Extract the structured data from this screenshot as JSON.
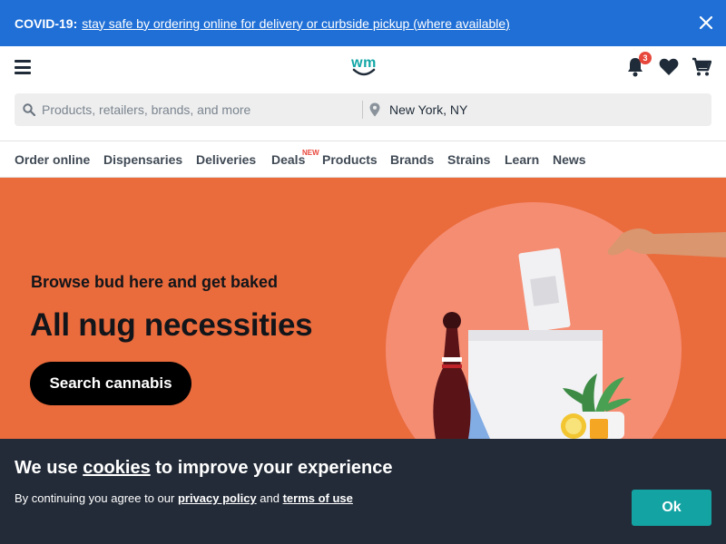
{
  "covid": {
    "label": "COVID-19:",
    "message": "stay safe by ordering online for delivery or curbside pickup (where available)"
  },
  "header": {
    "logo_text": "wm",
    "notification_count": "3"
  },
  "search": {
    "placeholder": "Products, retailers, brands, and more",
    "location_value": "New York, NY"
  },
  "nav": {
    "items": [
      {
        "label": "Order online"
      },
      {
        "label": "Dispensaries"
      },
      {
        "label": "Deliveries"
      },
      {
        "label": "Deals"
      },
      {
        "label": "Products"
      },
      {
        "label": "Brands"
      },
      {
        "label": "Strains"
      },
      {
        "label": "Learn"
      },
      {
        "label": "News"
      }
    ],
    "new_badge": "NEW"
  },
  "hero": {
    "subtitle": "Browse bud here and get baked",
    "title": "All nug necessities",
    "button_label": "Search cannabis"
  },
  "cookie": {
    "title_prefix": "We use ",
    "title_link": "cookies",
    "title_suffix": " to improve your experience",
    "text_prefix": "By continuing you agree to our ",
    "privacy_link": "privacy policy",
    "text_and": " and ",
    "terms_link": "terms of use",
    "ok_label": "Ok"
  },
  "colors": {
    "covid_blue": "#1f6fd6",
    "brand_teal": "#12a6a6",
    "hero_orange": "#ea6b3c",
    "cookie_bg": "#232b38"
  }
}
